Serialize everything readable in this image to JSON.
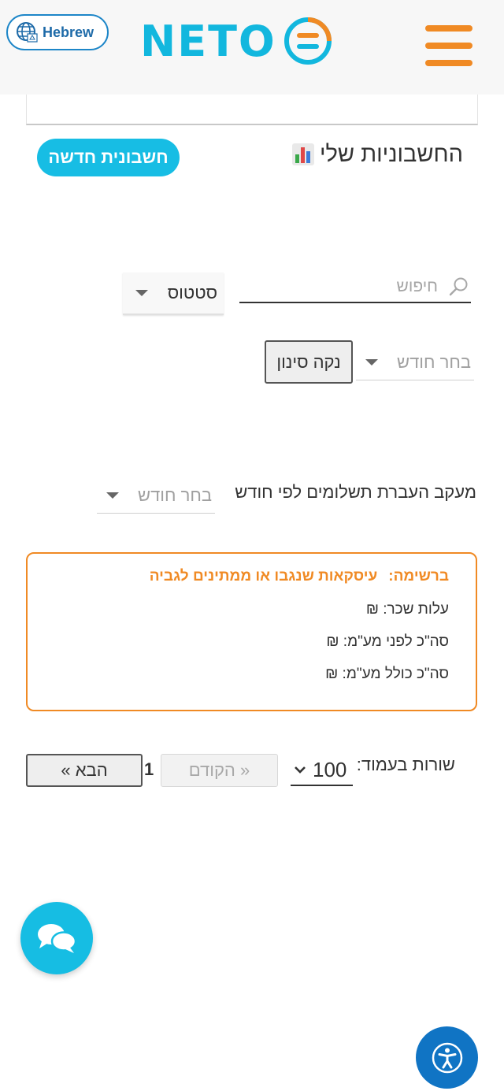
{
  "header": {
    "language_label": "Hebrew",
    "logo_text": "NETO",
    "colors": {
      "brand_blue": "#12b7de",
      "brand_orange": "#f08a24"
    }
  },
  "title_row": {
    "title": "החשבוניות שלי",
    "title_icon": "bar-chart-icon",
    "new_invoice_label": "חשבונית חדשה"
  },
  "filters": {
    "search_placeholder": "חיפוש",
    "status_label": "סטטוס",
    "month_placeholder": "בחר חודש",
    "clear_label": "נקה סינון"
  },
  "tracking": {
    "label": "מעקב העברת תשלומים לפי חודש",
    "month_placeholder": "בחר חודש"
  },
  "summary": {
    "heading_prefix": "ברשימה:",
    "heading_text": "עיסקאות שנגבו או ממתינים לגביה",
    "lines": [
      "עלות שכר: ₪",
      "סה\"כ לפני מע\"מ: ₪",
      "סה\"כ כולל מע\"מ: ₪"
    ]
  },
  "pagination": {
    "rows_label": "שורות בעמוד:",
    "rows_value": "100",
    "prev_label": "« הקודם",
    "page_number": "1",
    "next_label": "הבא »"
  }
}
